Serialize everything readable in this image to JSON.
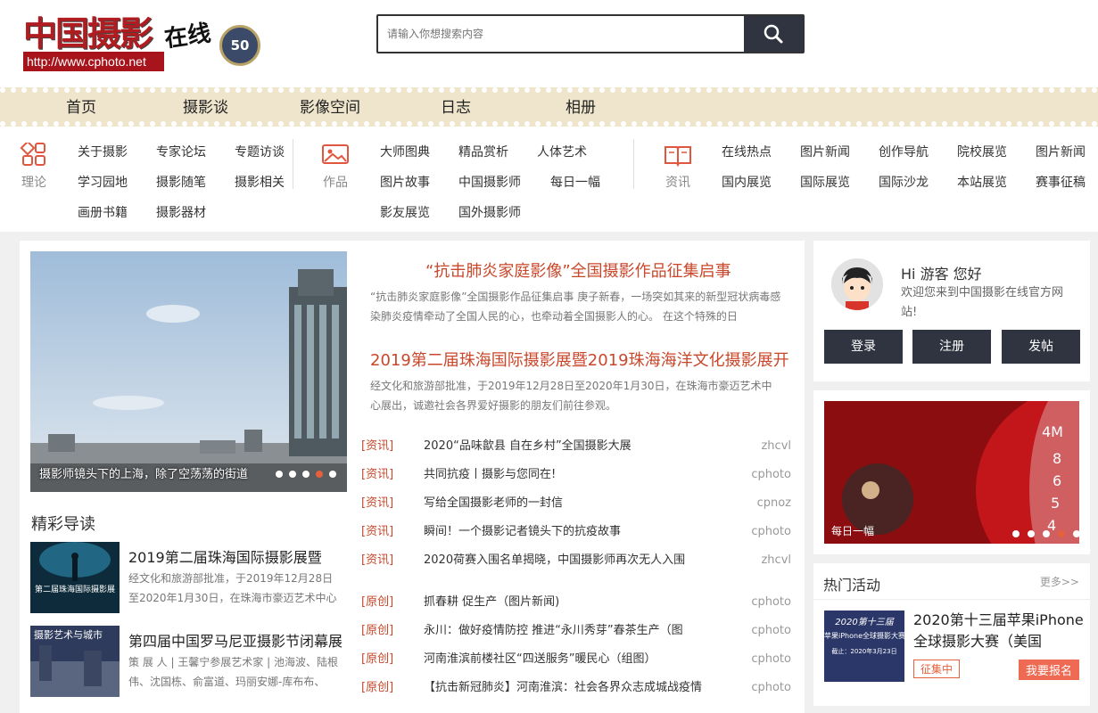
{
  "header": {
    "logo_text": "中国摄影",
    "logo_url": "http://www.cphoto.net",
    "logo_online": "在线",
    "logo_badge": "50",
    "search_placeholder": "请输入你想搜索内容"
  },
  "nav": {
    "items": [
      "首页",
      "摄影谈",
      "影像空间",
      "日志",
      "相册"
    ]
  },
  "subnav": {
    "groups": [
      {
        "label": "理论",
        "links": [
          "关于摄影",
          "专家论坛",
          "专题访谈",
          "学习园地",
          "摄影随笔",
          "摄影相关",
          "画册书籍",
          "摄影器材"
        ]
      },
      {
        "label": "作品",
        "links": [
          "大师图典",
          "精品赏析",
          "人体艺术",
          "图片故事",
          "中国摄影师",
          "每日一幅",
          "影友展览",
          "国外摄影师"
        ]
      },
      {
        "label": "资讯",
        "links": [
          "在线热点",
          "图片新闻",
          "创作导航",
          "院校展览",
          "图片新闻",
          "国内展览",
          "国际展览",
          "国际沙龙",
          "本站展览",
          "赛事征稿"
        ]
      }
    ]
  },
  "slider": {
    "caption": "摄影师镜头下的上海，除了空荡荡的街道"
  },
  "guide": {
    "title": "精彩导读",
    "items": [
      {
        "title": "2019第二届珠海国际摄影展暨",
        "desc": "经文化和旅游部批准，于2019年12月28日至2020年1月30日，在珠海市豪迈艺术中心展",
        "thumb_text": "第二届珠海国际摄影展"
      },
      {
        "title": "第四届中国罗马尼亚摄影节闭幕展",
        "desc": "策 展 人 | 王馨宁参展艺术家 | 池海波、陆根伟、沈国栋、俞富道、玛丽安娜-库布布、",
        "thumb_text": "摄影艺术与城市"
      }
    ]
  },
  "headlines": [
    {
      "title": "“抗击肺炎家庭影像”全国摄影作品征集启事",
      "desc": "“抗击肺炎家庭影像”全国摄影作品征集启事 庚子新春，一场突如其来的新型冠状病毒感染肺炎疫情牵动了全国人民的心，也牵动着全国摄影人的心。 在这个特殊的日"
    },
    {
      "title": "2019第二届珠海国际摄影展暨2019珠海海洋文化摄影展开",
      "desc": "经文化和旅游部批准，于2019年12月28日至2020年1月30日，在珠海市豪迈艺术中心展出，诚邀社会各界爱好摄影的朋友们前往参观。"
    }
  ],
  "news": [
    {
      "tag": "[资讯]",
      "title": "2020“品味歙县 自在乡村”全国摄影大展",
      "source": "zhcvl"
    },
    {
      "tag": "[资讯]",
      "title": "共同抗疫丨摄影与您同在!",
      "source": "cphoto"
    },
    {
      "tag": "[资讯]",
      "title": "写给全国摄影老师的一封信",
      "source": "cpnoz"
    },
    {
      "tag": "[资讯]",
      "title": "瞬间！一个摄影记者镜头下的抗疫故事",
      "source": "cphoto"
    },
    {
      "tag": "[资讯]",
      "title": "2020荷赛入围名单揭晓，中国摄影师再次无人入围",
      "source": "zhcvl"
    },
    {
      "tag": "[原创]",
      "title": "抓春耕 促生产（图片新闻)",
      "source": "cphoto"
    },
    {
      "tag": "[原创]",
      "title": "永川：做好疫情防控 推进“永川秀芽”春茶生产（图",
      "source": "cphoto"
    },
    {
      "tag": "[原创]",
      "title": "河南淮滨前楼社区“四送服务”暖民心（组图）",
      "source": "cphoto"
    },
    {
      "tag": "[原创]",
      "title": "【抗击新冠肺炎】河南淮滨：社会各界众志成城战疫情",
      "source": "cphoto"
    }
  ],
  "user": {
    "greeting": "Hi 游客 您好",
    "welcome": "欢迎您来到中国摄影在线官方网站!",
    "buttons": [
      "登录",
      "注册",
      "发帖"
    ]
  },
  "ad": {
    "caption": "每日一幅",
    "gauge_numbers": [
      "4M",
      "8",
      "6",
      "5",
      "4"
    ]
  },
  "hot": {
    "title": "热门活动",
    "more": "更多>>",
    "item_title": "2020第十三届苹果iPhone全球摄影大赛（美国",
    "thumb_lines": [
      "2020第十三届",
      "苹果iPhone全球摄影大赛",
      "截止：2020年3月23日"
    ],
    "status": "征集中",
    "signup": "我要报名"
  },
  "colors": {
    "accent": "#c9472a",
    "dark_button": "#2f3440",
    "nav_bg": "#efe5cc",
    "signup": "#ef6a52"
  }
}
